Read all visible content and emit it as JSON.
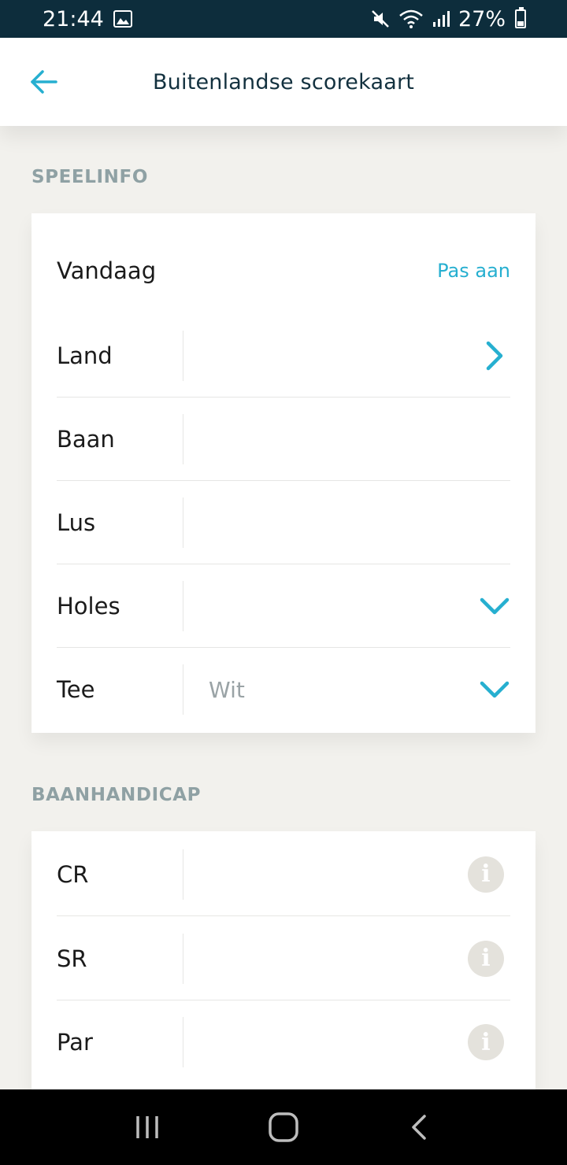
{
  "status_bar": {
    "time": "21:44",
    "battery": "27%",
    "icons": [
      "image-icon",
      "mute-icon",
      "wifi-icon",
      "signal-icon",
      "battery-icon"
    ]
  },
  "header": {
    "title": "Buitenlandse scorekaart",
    "back_icon": "arrow-left-icon"
  },
  "colors": {
    "accent": "#26afd0",
    "section_heading": "#8fa1a4",
    "background": "#f2f1ed",
    "status_bar": "#0d2d3c"
  },
  "speelinfo": {
    "heading": "SPEELINFO",
    "date": "Vandaag",
    "edit_label": "Pas aan",
    "rows": [
      {
        "label": "Land",
        "value": "",
        "icon": "chevron-right-icon"
      },
      {
        "label": "Baan",
        "value": ""
      },
      {
        "label": "Lus",
        "value": ""
      },
      {
        "label": "Holes",
        "value": "",
        "icon": "chevron-down-icon"
      },
      {
        "label": "Tee",
        "value": "Wit",
        "icon": "chevron-down-icon"
      }
    ]
  },
  "baanhandicap": {
    "heading": "BAANHANDICAP",
    "rows": [
      {
        "label": "CR",
        "value": "",
        "icon": "info-icon"
      },
      {
        "label": "SR",
        "value": "",
        "icon": "info-icon"
      },
      {
        "label": "Par",
        "value": "",
        "icon": "info-icon"
      }
    ],
    "info_glyph": "i"
  }
}
